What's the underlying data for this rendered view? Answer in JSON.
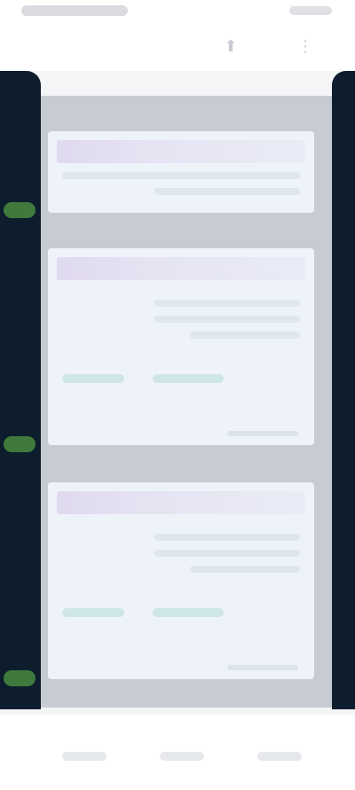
{
  "status_bar": {
    "icons": [
      "signal-icon",
      "battery-icon"
    ]
  },
  "toolbar": {
    "icons": [
      "share-icon",
      "more-icon"
    ]
  },
  "cards": [
    {
      "lines": 2
    },
    {
      "lines": 4
    },
    {
      "lines": 4
    }
  ],
  "bottom_nav": {
    "icons": [
      "home-icon",
      "search-icon",
      "profile-icon"
    ]
  },
  "colors": {
    "rail": "#0e1d2d",
    "marker": "#3f7a3c",
    "card": "#eef3fa",
    "card_header": "#e0d9ef"
  }
}
